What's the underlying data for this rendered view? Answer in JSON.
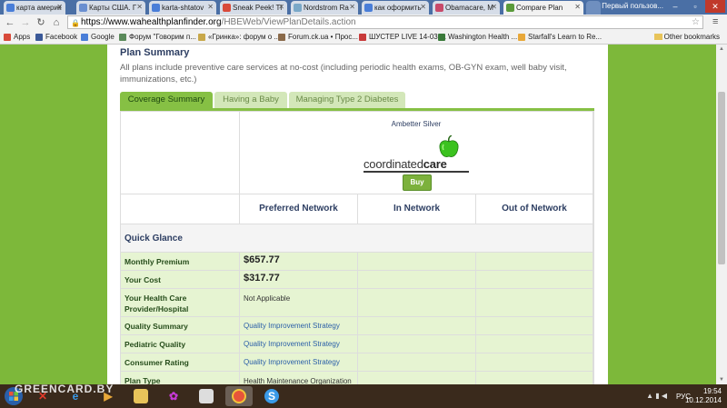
{
  "browser": {
    "tabs": [
      {
        "label": "карта америк",
        "color": "#4a7ed8"
      },
      {
        "label": "Карты США. Г",
        "color": "#6a8fd0"
      },
      {
        "label": "karta-shtatov",
        "color": "#4a7ed8"
      },
      {
        "label": "Sneak Peek! Tl",
        "color": "#d84a3a"
      },
      {
        "label": "Nordstrom Ra",
        "color": "#7aa8c8"
      },
      {
        "label": "как оформить",
        "color": "#4a7ed8"
      },
      {
        "label": "Obamacare, M",
        "color": "#c84a6a"
      },
      {
        "label": "Compare Plan",
        "color": "#5a9a3a"
      }
    ],
    "user_label": "Первый пользов...",
    "address": {
      "host": "https://www.wahealthplanfinder.org",
      "path": "/HBEWeb/ViewPlanDetails.action"
    },
    "bookmarks": [
      {
        "label": "Apps",
        "color": "#d84a3a"
      },
      {
        "label": "Facebook",
        "color": "#3b5998"
      },
      {
        "label": "Google",
        "color": "#4a7ed8"
      },
      {
        "label": "Форум \"Говорим п...",
        "color": "#5a8a5a"
      },
      {
        "label": "«Гринка»: форум о ...",
        "color": "#c8a84a"
      },
      {
        "label": "Forum.ck.ua • Прос...",
        "color": "#8a6a4a"
      },
      {
        "label": "ШУСТЕР LIVE 14-03-...",
        "color": "#c83a3a"
      },
      {
        "label": "Washington Health ...",
        "color": "#3a7a3a"
      },
      {
        "label": "Starfall's Learn to Re...",
        "color": "#e8a83a"
      }
    ],
    "other_bookmarks": "Other bookmarks"
  },
  "page": {
    "title": "Plan Summary",
    "description": "All plans include preventive care services at no-cost (including periodic health exams, OB-GYN exam, well baby visit, immunizations, etc.)",
    "tabs": [
      "Coverage Summary",
      "Having a Baby",
      "Managing Type 2 Diabetes"
    ],
    "carrier": {
      "name": "Ambetter Silver",
      "logo_plain": "coordinated",
      "logo_bold": "care",
      "buy_label": "Buy"
    },
    "columns": [
      "Preferred Network",
      "In Network",
      "Out of Network"
    ],
    "quick_glance": "Quick Glance",
    "rows": [
      {
        "label": "Monthly Premium",
        "value": "$657.77"
      },
      {
        "label": "Your Cost",
        "value": "$317.77"
      },
      {
        "label": "Your Health Care Provider/Hospital",
        "value": "Not Applicable"
      },
      {
        "label": "Quality Summary",
        "value": "Quality Improvement Strategy"
      },
      {
        "label": "Pediatric Quality",
        "value": "Quality Improvement Strategy"
      },
      {
        "label": "Consumer Rating",
        "value": "Quality Improvement Strategy"
      },
      {
        "label": "Plan Type",
        "value": "Health Maintenance Organization (HMO)"
      }
    ]
  },
  "taskbar": {
    "watermark": "GREENCARD.BY",
    "lang": "РУС",
    "time": "19:54",
    "date": "10.12.2014"
  }
}
